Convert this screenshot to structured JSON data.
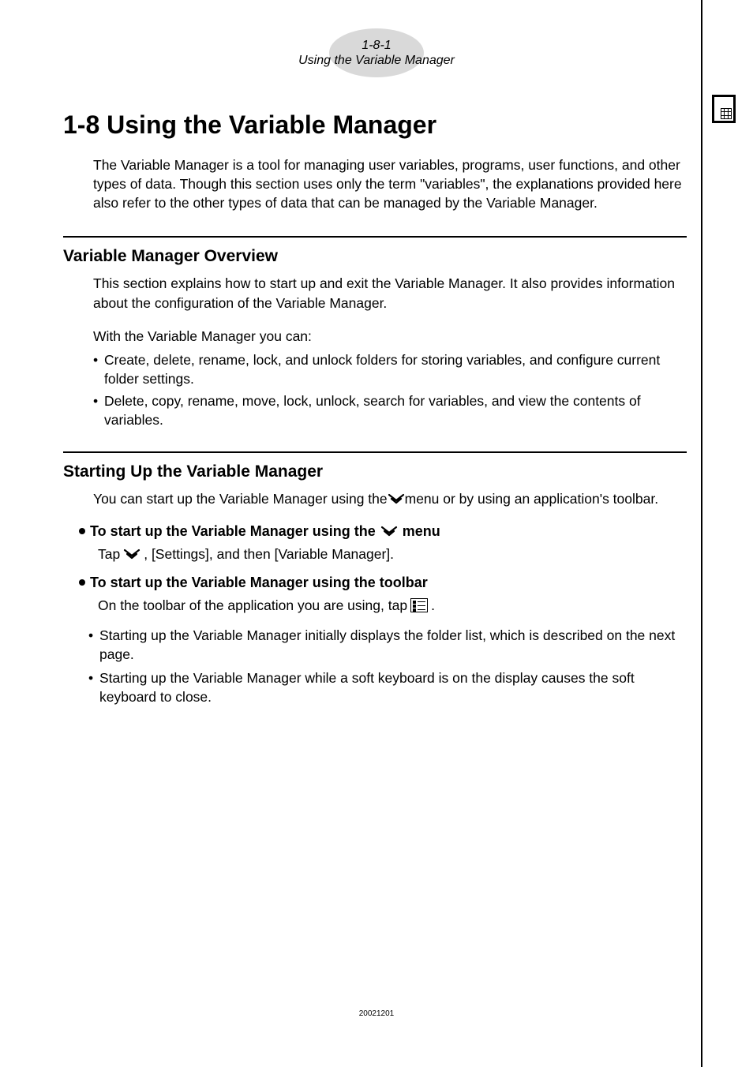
{
  "header": {
    "page_ref": "1-8-1",
    "page_title": "Using the Variable Manager"
  },
  "content": {
    "h1": "1-8  Using the Variable Manager",
    "intro": "The Variable Manager is a tool for managing user variables, programs, user functions, and other types of data. Though this section uses only the term \"variables\", the explanations provided here also refer to the other types of data that can be managed by the Variable Manager.",
    "section1": {
      "heading": "Variable Manager Overview",
      "para": "This section explains how to start up and exit the Variable Manager. It also provides information about the configuration of the Variable Manager.",
      "with_line": "With the Variable Manager you can:",
      "bullets": [
        "Create, delete, rename, lock, and unlock folders for storing variables, and configure current folder settings.",
        "Delete, copy, rename, move, lock, unlock, search for variables, and view the contents of variables."
      ]
    },
    "section2": {
      "heading": "Starting Up the Variable Manager",
      "para_a": "You can start up the Variable Manager using the ",
      "para_b": " menu or by using an application's toolbar.",
      "sub1_a": "To start up the Variable Manager using the ",
      "sub1_b": " menu",
      "tap1_a": "Tap ",
      "tap1_b": " , [Settings], and then [Variable Manager].",
      "sub2": "To start up the Variable Manager using the toolbar",
      "tap2_a": "On the toolbar of the application you are using, tap ",
      "tap2_b": ".",
      "bullets": [
        "Starting up the Variable Manager initially displays the folder list, which is described on the next page.",
        "Starting up the Variable Manager while a soft keyboard is on the display causes the soft keyboard to close."
      ]
    }
  },
  "footer": {
    "date_code": "20021201"
  }
}
